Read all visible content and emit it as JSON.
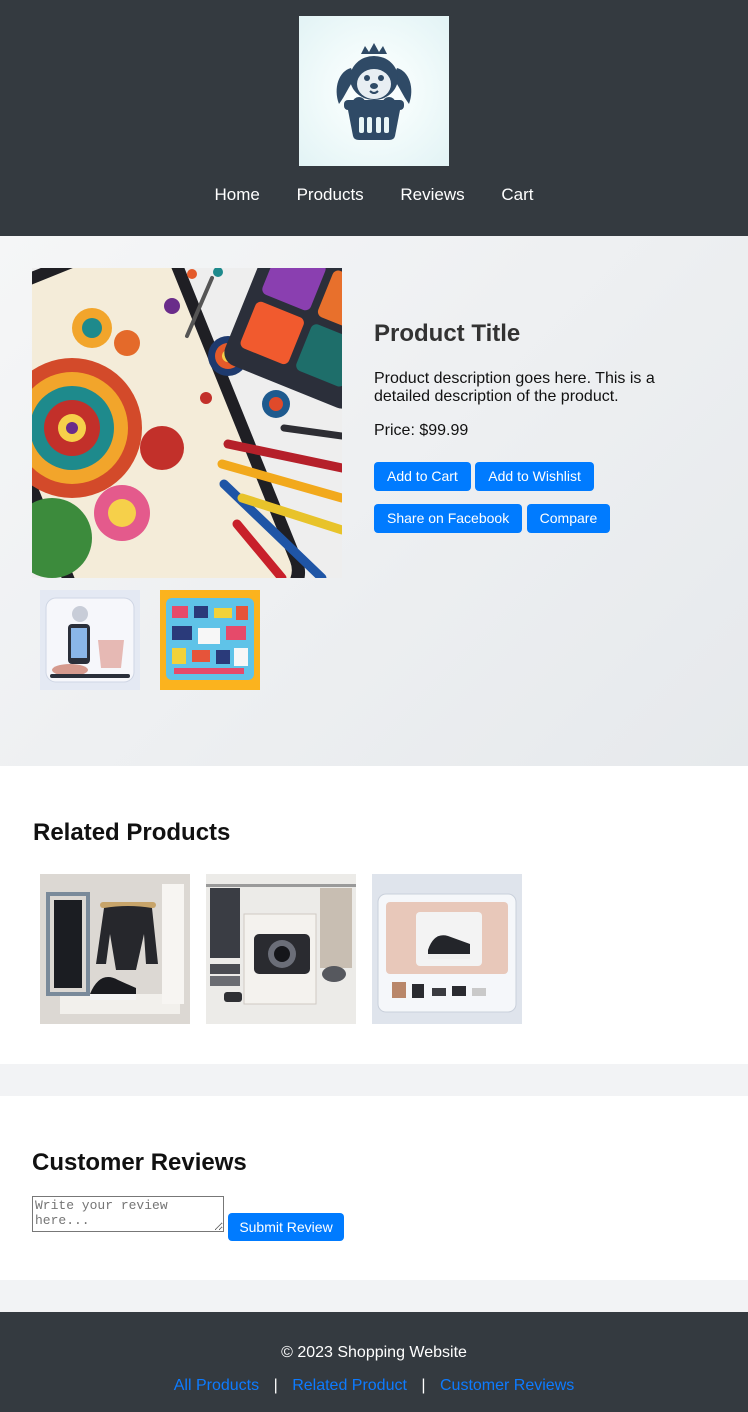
{
  "header": {
    "nav": [
      "Home",
      "Products",
      "Reviews",
      "Cart"
    ]
  },
  "product": {
    "title": "Product Title",
    "description": "Product description goes here. This is a detailed description of the product.",
    "price": "Price: $99.99",
    "buttons": {
      "add_to_cart": "Add to Cart",
      "add_to_wishlist": "Add to Wishlist",
      "share_facebook": "Share on Facebook",
      "compare": "Compare"
    }
  },
  "related": {
    "heading": "Related Products"
  },
  "reviews": {
    "heading": "Customer Reviews",
    "placeholder": "Write your review here...",
    "submit_label": "Submit Review"
  },
  "footer": {
    "copyright": "© 2023 Shopping Website",
    "links": [
      "All Products",
      "Related Product",
      "Customer Reviews"
    ],
    "separator": "|"
  },
  "colors": {
    "header_bg": "#343a40",
    "accent": "#007bff"
  }
}
